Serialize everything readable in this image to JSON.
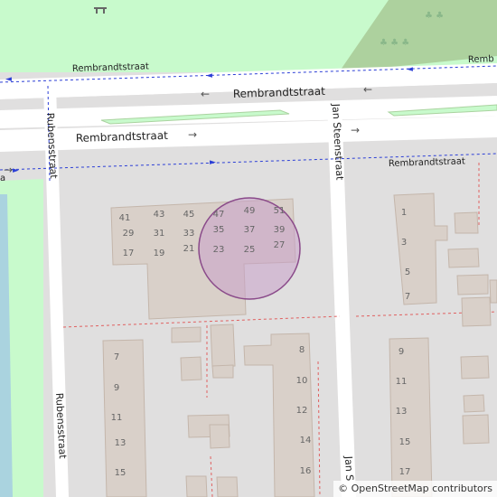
{
  "map": {
    "streets": {
      "rembrandtstraat_north": "Rembrandtstraat",
      "rembrandtstraat_main": "Rembrandtstraat",
      "rembrandtstraat_south": "Rembrandtstraat",
      "rembrandtstraat_path": "Rembrandtstraat",
      "rubensstraat_top": "Rubensstraat",
      "rubensstraat_bottom": "Rubensstraat",
      "jan_steenstraat_top": "Jan Steenstraat",
      "jan_steenstraat_bottom": "Jan S",
      "rembrandtstraat_edge": "Remb"
    },
    "house_numbers_block_a": [
      "41",
      "43",
      "45",
      "47",
      "49",
      "51",
      "29",
      "31",
      "33",
      "35",
      "37",
      "39",
      "17",
      "19",
      "21",
      "23",
      "25",
      "27"
    ],
    "house_numbers_right_top": [
      "1",
      "3",
      "5",
      "7"
    ],
    "house_numbers_left": [
      "7",
      "9",
      "11",
      "13",
      "15"
    ],
    "house_numbers_middle": [
      "8",
      "10",
      "12",
      "14",
      "16"
    ],
    "house_numbers_right": [
      "9",
      "11",
      "13",
      "15",
      "17"
    ],
    "colors": {
      "background": "#e0dfdf",
      "road": "#ffffff",
      "park": "#c8facc",
      "forest": "#add19e",
      "water": "#aad3df",
      "building": "#d9d0c9",
      "building_stroke": "#c4b6ab",
      "highlight": "#c8a0c8"
    }
  },
  "attribution": {
    "symbol": "©",
    "text": "OpenStreetMap contributors"
  }
}
